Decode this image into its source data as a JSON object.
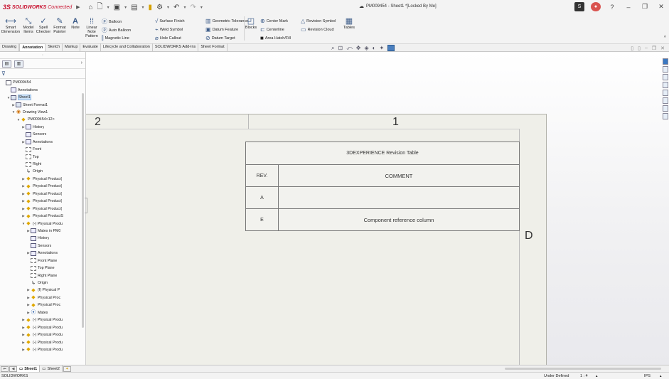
{
  "titlebar": {
    "brand_ds": "3S",
    "brand_name": "SOLIDWORKS",
    "brand_suffix": "Connected",
    "document_title": "PM009454 - Sheet1 *[Locked By Me]",
    "right_badge": "S"
  },
  "ribbon": {
    "smart_dimension": "Smart Dimension",
    "model_items": "Model Items",
    "spell_checker": "Spell Checker",
    "format_painter": "Format Painter",
    "note": "Note",
    "linear_note_pattern": "Linear Note Pattern",
    "balloon": "Balloon",
    "auto_balloon": "Auto Balloon",
    "magnetic_line": "Magnetic Line",
    "surface_finish": "Surface Finish",
    "weld_symbol": "Weld Symbol",
    "hole_callout": "Hole Callout",
    "geometric_tolerance": "Geometric Tolerance",
    "datum_feature": "Datum Feature",
    "datum_target": "Datum Target",
    "blocks": "Blocks",
    "center_mark": "Center Mark",
    "centerline": "Centerline",
    "area_hatch_fill": "Area Hatch/Fill",
    "revision_symbol": "Revision Symbol",
    "revision_cloud": "Revision Cloud",
    "tables": "Tables"
  },
  "command_tabs": [
    {
      "label": "Drawing",
      "active": false
    },
    {
      "label": "Annotation",
      "active": true
    },
    {
      "label": "Sketch",
      "active": false
    },
    {
      "label": "Markup",
      "active": false
    },
    {
      "label": "Evaluate",
      "active": false
    },
    {
      "label": "Lifecycle and Collaboration",
      "active": false
    },
    {
      "label": "SOLIDWORKS Add-Ins",
      "active": false
    },
    {
      "label": "Sheet Format",
      "active": false
    }
  ],
  "tree": [
    {
      "label": "PM009454",
      "depth": 0,
      "exp": "",
      "icon": "doc"
    },
    {
      "label": "Annotations",
      "depth": 1,
      "exp": "",
      "icon": "ann"
    },
    {
      "label": "Sheet1",
      "depth": 1,
      "exp": "▼",
      "icon": "sheet",
      "selected": true
    },
    {
      "label": "Sheet Format1",
      "depth": 2,
      "exp": "▶",
      "icon": "sheet"
    },
    {
      "label": "Drawing View1",
      "depth": 2,
      "exp": "▼",
      "icon": "view"
    },
    {
      "label": "PM009454<12>",
      "depth": 3,
      "exp": "▼",
      "icon": "yel"
    },
    {
      "label": "History",
      "depth": 4,
      "exp": "▶",
      "icon": "ann"
    },
    {
      "label": "Sensors",
      "depth": 4,
      "exp": "",
      "icon": "ann"
    },
    {
      "label": "Annotations",
      "depth": 4,
      "exp": "▶",
      "icon": "ann"
    },
    {
      "label": "Front",
      "depth": 4,
      "exp": "",
      "icon": "plane"
    },
    {
      "label": "Top",
      "depth": 4,
      "exp": "",
      "icon": "plane"
    },
    {
      "label": "Right",
      "depth": 4,
      "exp": "",
      "icon": "plane"
    },
    {
      "label": "Origin",
      "depth": 4,
      "exp": "",
      "icon": "origin"
    },
    {
      "label": "Physical Product(",
      "depth": 4,
      "exp": "▶",
      "icon": "yel"
    },
    {
      "label": "Physical Product(",
      "depth": 4,
      "exp": "▶",
      "icon": "yel"
    },
    {
      "label": "Physical Product(",
      "depth": 4,
      "exp": "▶",
      "icon": "yel"
    },
    {
      "label": "Physical Product(",
      "depth": 4,
      "exp": "▶",
      "icon": "yel"
    },
    {
      "label": "Physical Product(",
      "depth": 4,
      "exp": "▶",
      "icon": "yel"
    },
    {
      "label": "Physical ProductS",
      "depth": 4,
      "exp": "▶",
      "icon": "yel"
    },
    {
      "label": "(-) Physical Produ",
      "depth": 4,
      "exp": "▼",
      "icon": "yel"
    },
    {
      "label": "Mates in PM0",
      "depth": 5,
      "exp": "▶",
      "icon": "ann"
    },
    {
      "label": "History",
      "depth": 5,
      "exp": "",
      "icon": "ann"
    },
    {
      "label": "Sensors",
      "depth": 5,
      "exp": "",
      "icon": "ann"
    },
    {
      "label": "Annotations",
      "depth": 5,
      "exp": "▶",
      "icon": "ann"
    },
    {
      "label": "Front Plane",
      "depth": 5,
      "exp": "",
      "icon": "plane"
    },
    {
      "label": "Top Plane",
      "depth": 5,
      "exp": "",
      "icon": "plane"
    },
    {
      "label": "Right Plane",
      "depth": 5,
      "exp": "",
      "icon": "plane"
    },
    {
      "label": "Origin",
      "depth": 5,
      "exp": "",
      "icon": "origin"
    },
    {
      "label": "(f) Physical P",
      "depth": 5,
      "exp": "▶",
      "icon": "yel"
    },
    {
      "label": "Physical Proc",
      "depth": 5,
      "exp": "▶",
      "icon": "yel"
    },
    {
      "label": "Physical Proc",
      "depth": 5,
      "exp": "▶",
      "icon": "yel"
    },
    {
      "label": "Mates",
      "depth": 5,
      "exp": "▶",
      "icon": "blue"
    },
    {
      "label": "(-) Physical Produ",
      "depth": 4,
      "exp": "▶",
      "icon": "yel"
    },
    {
      "label": "(-) Physical Produ",
      "depth": 4,
      "exp": "▶",
      "icon": "yel"
    },
    {
      "label": "(-) Physical Produ",
      "depth": 4,
      "exp": "▶",
      "icon": "yel"
    },
    {
      "label": "(-) Physical Produ",
      "depth": 4,
      "exp": "▶",
      "icon": "yel"
    },
    {
      "label": "(-) Physical Produ",
      "depth": 4,
      "exp": "▶",
      "icon": "yel"
    }
  ],
  "drawing": {
    "zone_2": "2",
    "zone_1": "1",
    "zone_d": "D",
    "table_title": "3DEXPERIENCE Revision Table",
    "col_rev": "REV.",
    "col_comment": "COMMENT",
    "rows": [
      {
        "rev": "A",
        "comment": ""
      },
      {
        "rev": "E",
        "comment": "Component reference column"
      }
    ]
  },
  "sheet_tabs": [
    {
      "label": "Sheet1",
      "active": true
    },
    {
      "label": "Sheet2",
      "active": false
    }
  ],
  "status": {
    "app": "SOLIDWORKS",
    "state": "Under Defined",
    "scale": "1 : 4",
    "units": "IPS"
  }
}
